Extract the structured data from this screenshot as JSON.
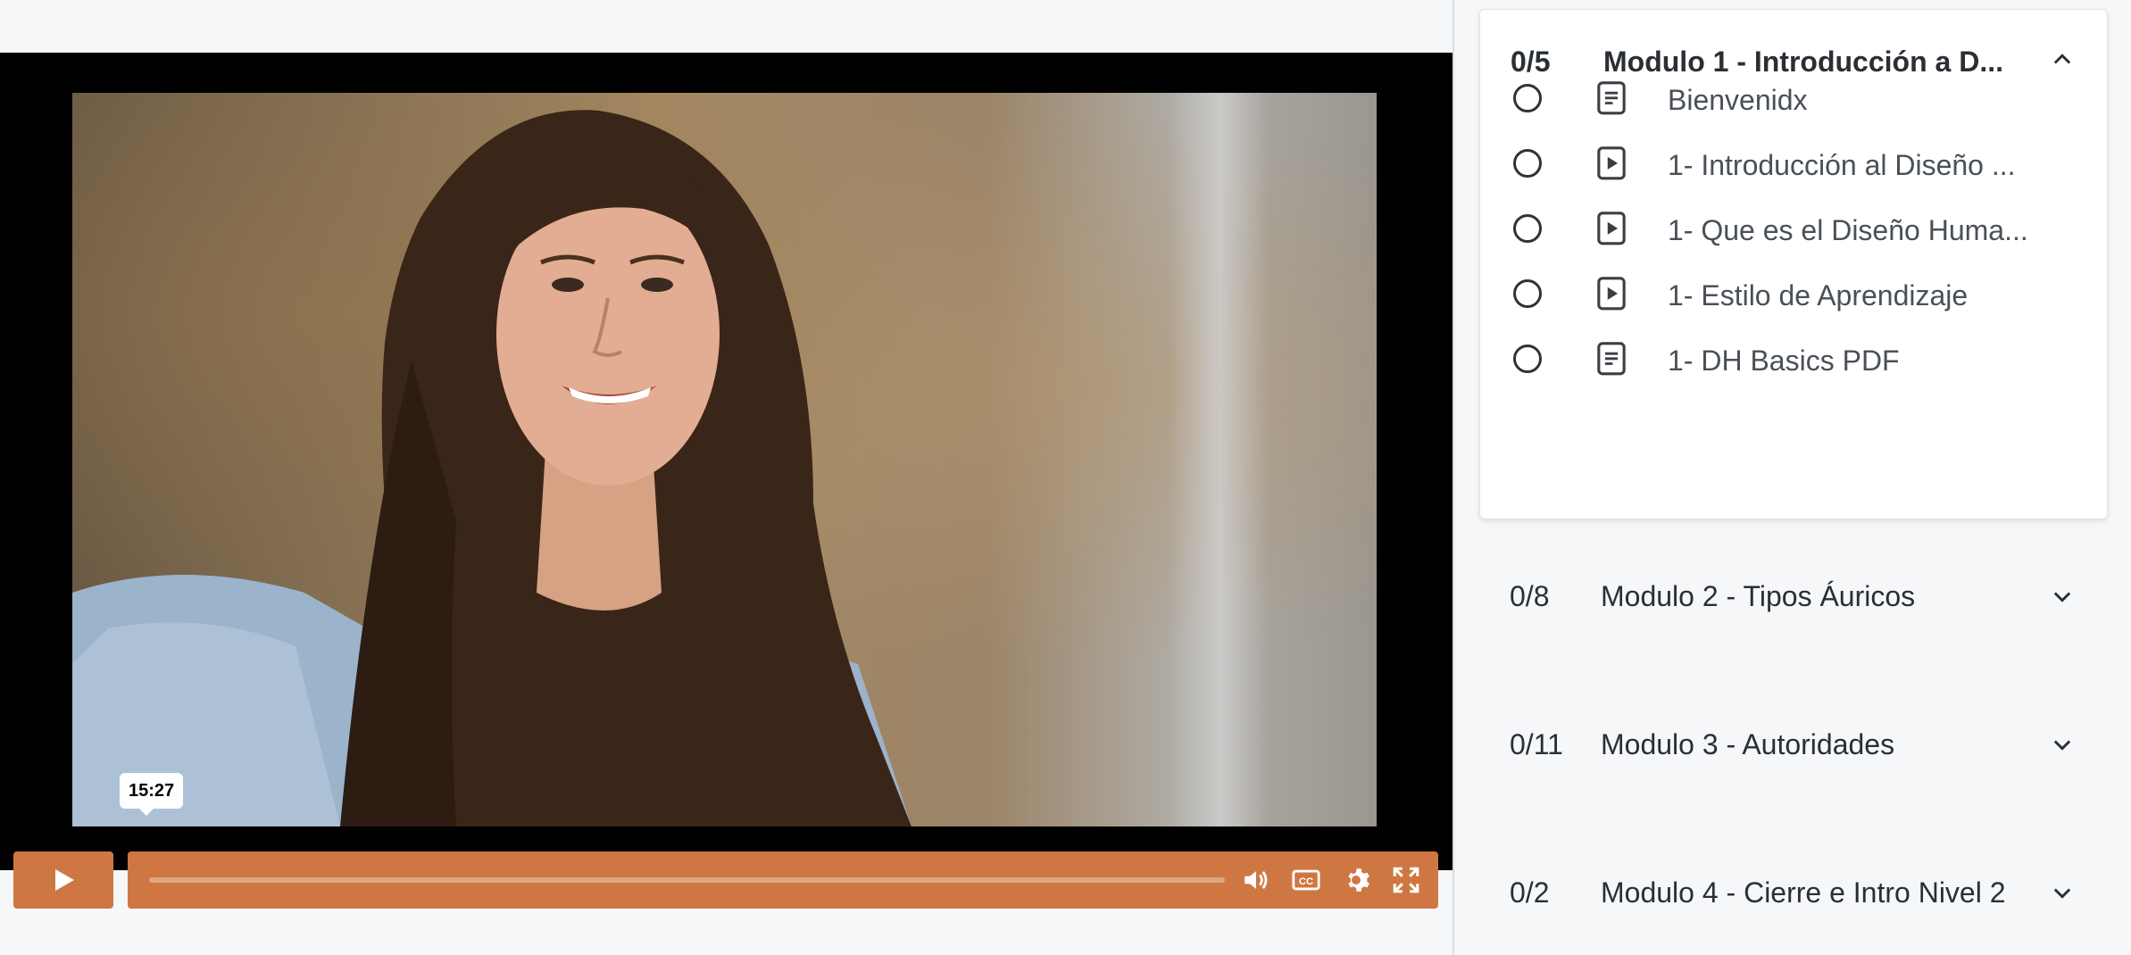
{
  "player": {
    "timestamp": "15:27",
    "progress_fraction": 0.0,
    "accent_color": "#cf7743"
  },
  "sidebar": {
    "open_module": {
      "count": "0/5",
      "title": "Modulo 1 - Introducción a D...",
      "lessons": [
        {
          "title": "Bienvenidx",
          "type": "document-icon"
        },
        {
          "title": "1- Introducción al Diseño ...",
          "type": "video-icon"
        },
        {
          "title": "1- Que es el Diseño Huma...",
          "type": "video-icon"
        },
        {
          "title": "1- Estilo de Aprendizaje",
          "type": "video-icon"
        },
        {
          "title": "1- DH Basics PDF",
          "type": "document-icon"
        }
      ]
    },
    "modules": [
      {
        "count": "0/8",
        "title": "Modulo 2 - Tipos Áuricos"
      },
      {
        "count": "0/11",
        "title": "Modulo 3 - Autoridades"
      },
      {
        "count": "0/2",
        "title": "Modulo 4 - Cierre e Intro Nivel 2"
      }
    ]
  }
}
